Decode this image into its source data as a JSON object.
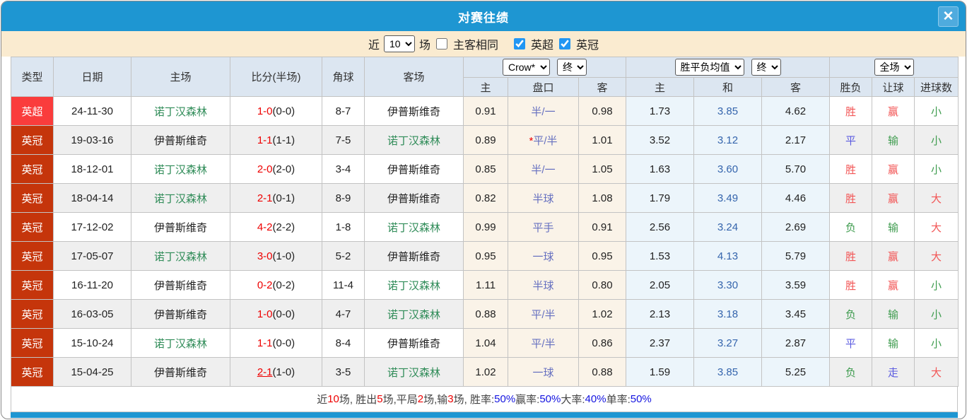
{
  "window": {
    "title": "对赛往绩",
    "close_glyph": "✕"
  },
  "filter": {
    "recent_label": "近",
    "recent_count": "10",
    "matches_label": "场",
    "same_venue_label": "主客相同",
    "same_venue_checked": false,
    "leagues": [
      {
        "label": "英超",
        "checked": true
      },
      {
        "label": "英冠",
        "checked": true
      }
    ]
  },
  "table": {
    "main_headers": [
      "类型",
      "日期",
      "主场",
      "比分(半场)",
      "角球",
      "客场"
    ],
    "group_selects": {
      "bookmaker": "Crow*",
      "bookmaker_stage": "终",
      "avg_label": "胜平负均值",
      "avg_stage": "终",
      "scope": "全场"
    },
    "sub_headers": {
      "odds_home": "主",
      "odds_handicap": "盘口",
      "odds_away": "客",
      "avg_home": "主",
      "avg_draw": "和",
      "avg_away": "客",
      "res_outcome": "胜负",
      "res_handicap": "让球",
      "res_goals": "进球数"
    },
    "rows": [
      {
        "league": "英超",
        "league_color": "super",
        "date": "24-11-30",
        "home": "诺丁汉森林",
        "home_color": "green",
        "score_main": "1-0",
        "score_half": "(0-0)",
        "score_underline": false,
        "corner": "8-7",
        "away": "伊普斯维奇",
        "away_color": "black",
        "odds_home": "0.91",
        "handicap_star": "",
        "handicap": "半/一",
        "odds_away": "0.98",
        "avg_home": "1.73",
        "avg_draw": "3.85",
        "avg_away": "4.62",
        "res_outcome": "胜",
        "res_outcome_color": "red",
        "res_handicap": "赢",
        "res_handicap_color": "red",
        "res_goals": "小",
        "res_goals_color": "green"
      },
      {
        "league": "英冠",
        "league_color": "champ",
        "date": "19-03-16",
        "home": "伊普斯维奇",
        "home_color": "black",
        "score_main": "1-1",
        "score_half": "(1-1)",
        "score_underline": false,
        "corner": "7-5",
        "away": "诺丁汉森林",
        "away_color": "green",
        "odds_home": "0.89",
        "handicap_star": "*",
        "handicap": "平/半",
        "odds_away": "1.01",
        "avg_home": "3.52",
        "avg_draw": "3.12",
        "avg_away": "2.17",
        "res_outcome": "平",
        "res_outcome_color": "blue",
        "res_handicap": "输",
        "res_handicap_color": "green",
        "res_goals": "小",
        "res_goals_color": "green"
      },
      {
        "league": "英冠",
        "league_color": "champ",
        "date": "18-12-01",
        "home": "诺丁汉森林",
        "home_color": "green",
        "score_main": "2-0",
        "score_half": "(2-0)",
        "score_underline": false,
        "corner": "3-4",
        "away": "伊普斯维奇",
        "away_color": "black",
        "odds_home": "0.85",
        "handicap_star": "",
        "handicap": "半/一",
        "odds_away": "1.05",
        "avg_home": "1.63",
        "avg_draw": "3.60",
        "avg_away": "5.70",
        "res_outcome": "胜",
        "res_outcome_color": "red",
        "res_handicap": "赢",
        "res_handicap_color": "red",
        "res_goals": "小",
        "res_goals_color": "green"
      },
      {
        "league": "英冠",
        "league_color": "champ",
        "date": "18-04-14",
        "home": "诺丁汉森林",
        "home_color": "green",
        "score_main": "2-1",
        "score_half": "(0-1)",
        "score_underline": false,
        "corner": "8-9",
        "away": "伊普斯维奇",
        "away_color": "black",
        "odds_home": "0.82",
        "handicap_star": "",
        "handicap": "半球",
        "odds_away": "1.08",
        "avg_home": "1.79",
        "avg_draw": "3.49",
        "avg_away": "4.46",
        "res_outcome": "胜",
        "res_outcome_color": "red",
        "res_handicap": "赢",
        "res_handicap_color": "red",
        "res_goals": "大",
        "res_goals_color": "red"
      },
      {
        "league": "英冠",
        "league_color": "champ",
        "date": "17-12-02",
        "home": "伊普斯维奇",
        "home_color": "black",
        "score_main": "4-2",
        "score_half": "(2-2)",
        "score_underline": false,
        "corner": "1-8",
        "away": "诺丁汉森林",
        "away_color": "green",
        "odds_home": "0.99",
        "handicap_star": "",
        "handicap": "平手",
        "odds_away": "0.91",
        "avg_home": "2.56",
        "avg_draw": "3.24",
        "avg_away": "2.69",
        "res_outcome": "负",
        "res_outcome_color": "green",
        "res_handicap": "输",
        "res_handicap_color": "green",
        "res_goals": "大",
        "res_goals_color": "red"
      },
      {
        "league": "英冠",
        "league_color": "champ",
        "date": "17-05-07",
        "home": "诺丁汉森林",
        "home_color": "green",
        "score_main": "3-0",
        "score_half": "(1-0)",
        "score_underline": false,
        "corner": "5-2",
        "away": "伊普斯维奇",
        "away_color": "black",
        "odds_home": "0.95",
        "handicap_star": "",
        "handicap": "一球",
        "odds_away": "0.95",
        "avg_home": "1.53",
        "avg_draw": "4.13",
        "avg_away": "5.79",
        "res_outcome": "胜",
        "res_outcome_color": "red",
        "res_handicap": "赢",
        "res_handicap_color": "red",
        "res_goals": "大",
        "res_goals_color": "red"
      },
      {
        "league": "英冠",
        "league_color": "champ",
        "date": "16-11-20",
        "home": "伊普斯维奇",
        "home_color": "black",
        "score_main": "0-2",
        "score_half": "(0-2)",
        "score_underline": false,
        "corner": "11-4",
        "away": "诺丁汉森林",
        "away_color": "green",
        "odds_home": "1.11",
        "handicap_star": "",
        "handicap": "半球",
        "odds_away": "0.80",
        "avg_home": "2.05",
        "avg_draw": "3.30",
        "avg_away": "3.59",
        "res_outcome": "胜",
        "res_outcome_color": "red",
        "res_handicap": "赢",
        "res_handicap_color": "red",
        "res_goals": "小",
        "res_goals_color": "green"
      },
      {
        "league": "英冠",
        "league_color": "champ",
        "date": "16-03-05",
        "home": "伊普斯维奇",
        "home_color": "black",
        "score_main": "1-0",
        "score_half": "(0-0)",
        "score_underline": false,
        "corner": "4-7",
        "away": "诺丁汉森林",
        "away_color": "green",
        "odds_home": "0.88",
        "handicap_star": "",
        "handicap": "平/半",
        "odds_away": "1.02",
        "avg_home": "2.13",
        "avg_draw": "3.18",
        "avg_away": "3.45",
        "res_outcome": "负",
        "res_outcome_color": "green",
        "res_handicap": "输",
        "res_handicap_color": "green",
        "res_goals": "小",
        "res_goals_color": "green"
      },
      {
        "league": "英冠",
        "league_color": "champ",
        "date": "15-10-24",
        "home": "诺丁汉森林",
        "home_color": "green",
        "score_main": "1-1",
        "score_half": "(0-0)",
        "score_underline": false,
        "corner": "8-4",
        "away": "伊普斯维奇",
        "away_color": "black",
        "odds_home": "1.04",
        "handicap_star": "",
        "handicap": "平/半",
        "odds_away": "0.86",
        "avg_home": "2.37",
        "avg_draw": "3.27",
        "avg_away": "2.87",
        "res_outcome": "平",
        "res_outcome_color": "blue",
        "res_handicap": "输",
        "res_handicap_color": "green",
        "res_goals": "小",
        "res_goals_color": "green"
      },
      {
        "league": "英冠",
        "league_color": "champ",
        "date": "15-04-25",
        "home": "伊普斯维奇",
        "home_color": "black",
        "score_main": "2-1",
        "score_half": "(1-0)",
        "score_underline": true,
        "corner": "3-5",
        "away": "诺丁汉森林",
        "away_color": "green",
        "odds_home": "1.02",
        "handicap_star": "",
        "handicap": "一球",
        "odds_away": "0.88",
        "avg_home": "1.59",
        "avg_draw": "3.85",
        "avg_away": "5.25",
        "res_outcome": "负",
        "res_outcome_color": "green",
        "res_handicap": "走",
        "res_handicap_color": "blue",
        "res_goals": "大",
        "res_goals_color": "red"
      }
    ]
  },
  "footer": {
    "segments": [
      {
        "text": "近 ",
        "color": "dark"
      },
      {
        "text": "10",
        "color": "red"
      },
      {
        "text": " 场, 胜出 ",
        "color": "dark"
      },
      {
        "text": "5",
        "color": "red"
      },
      {
        "text": " 场,平局 ",
        "color": "dark"
      },
      {
        "text": "2",
        "color": "red"
      },
      {
        "text": " 场,输 ",
        "color": "dark"
      },
      {
        "text": "3",
        "color": "red"
      },
      {
        "text": " 场, 胜率: ",
        "color": "dark"
      },
      {
        "text": "50%",
        "color": "blue"
      },
      {
        "text": " 赢率: ",
        "color": "dark"
      },
      {
        "text": "50%",
        "color": "blue"
      },
      {
        "text": " 大率: ",
        "color": "dark"
      },
      {
        "text": "40%",
        "color": "blue"
      },
      {
        "text": " 单率: ",
        "color": "dark"
      },
      {
        "text": "50%",
        "color": "blue"
      }
    ]
  },
  "colors": {
    "titlebar": "#1e96d2",
    "filterbar_bg": "#faebd0",
    "header_bg": "#dce6f1",
    "badge_premier": "#fa3c3c",
    "badge_championship": "#c5350b",
    "team_green": "#2e8b57",
    "score_red": "#ee0000",
    "handicap_text": "#6670c0",
    "avg_draw_text": "#3565ad",
    "result_red": "#f25555",
    "result_green": "#3f9c4f",
    "result_blue": "#5b5be0",
    "footer_pct_blue": "#1414e0",
    "bottombar": "#1e96d2"
  }
}
